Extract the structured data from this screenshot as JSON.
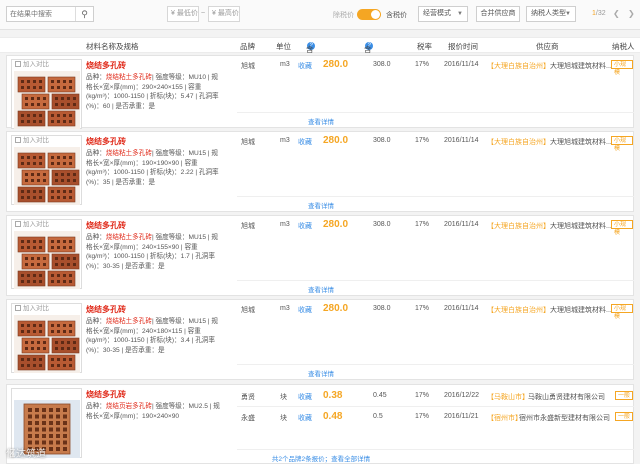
{
  "toolbar": {
    "search_placeholder": "在结果中搜索",
    "price_min": "¥ 最低价",
    "price_max": "¥ 最高价",
    "tilde": "~",
    "toggle_left": "除税价",
    "toggle_right": "含税价",
    "sort_mode": "经营模式",
    "merge_supplier": "合并供应商",
    "taxpayer_type": "纳税人类型",
    "page_current": "1",
    "page_total": "/32",
    "accent": "#f5a623"
  },
  "table_header": {
    "name": "材料名称及规格",
    "brand": "品牌",
    "unit": "单位",
    "market_price": "含税市场价",
    "info_price": "含税信息价",
    "tax_rate": "税率",
    "report_time": "报价时间",
    "supplier": "供应商",
    "taxpayer": "纳税人"
  },
  "cards": [
    {
      "compare": "加入对比",
      "name": "烧结多孔砖",
      "spec_lines": [
        [
          "品种：",
          "烧结粘土多孔砖",
          "| 强度等级：MU10 | 规"
        ],
        [
          "格长×宽×厚(mm)：290×240×155 | 容重"
        ],
        [
          "(kg/m³)：1000-1150 | 折标(块)：5.47 | 孔洞率"
        ],
        [
          "(%)：60 | 是否承重：是"
        ]
      ],
      "rows": [
        {
          "brand": "旭城",
          "unit": "m3",
          "fav": "收藏",
          "price": "280.0",
          "info": "308.0",
          "tax": "17%",
          "time": "2016/11/14",
          "region": "【大理白族自治州】",
          "supplier": "大理旭城建筑材料...",
          "tag": "小规模"
        }
      ],
      "more": "查看详情"
    },
    {
      "compare": "加入对比",
      "name": "烧结多孔砖",
      "spec_lines": [
        [
          "品种：",
          "烧结粘土多孔砖",
          "| 强度等级：MU15 | 规"
        ],
        [
          "格长×宽×厚(mm)：190×190×90 | 容重"
        ],
        [
          "(kg/m³)：1000-1150 | 折标(块)：2.22 | 孔洞率"
        ],
        [
          "(%)：35 | 是否承重：是"
        ]
      ],
      "rows": [
        {
          "brand": "旭城",
          "unit": "m3",
          "fav": "收藏",
          "price": "280.0",
          "info": "308.0",
          "tax": "17%",
          "time": "2016/11/14",
          "region": "【大理白族自治州】",
          "supplier": "大理旭城建筑材料...",
          "tag": "小规模"
        }
      ],
      "more": "查看详情"
    },
    {
      "compare": "加入对比",
      "name": "烧结多孔砖",
      "spec_lines": [
        [
          "品种：",
          "烧结粘土多孔砖",
          "| 强度等级：MU15 | 规"
        ],
        [
          "格长×宽×厚(mm)：240×155×90 | 容重"
        ],
        [
          "(kg/m³)：1000-1150 | 折标(块)：1.7 | 孔洞率"
        ],
        [
          "(%)：30-35 | 是否承重：是"
        ]
      ],
      "rows": [
        {
          "brand": "旭城",
          "unit": "m3",
          "fav": "收藏",
          "price": "280.0",
          "info": "308.0",
          "tax": "17%",
          "time": "2016/11/14",
          "region": "【大理白族自治州】",
          "supplier": "大理旭城建筑材料...",
          "tag": "小规模"
        }
      ],
      "more": "查看详情"
    },
    {
      "compare": "加入对比",
      "name": "烧结多孔砖",
      "spec_lines": [
        [
          "品种：",
          "烧结粘土多孔砖",
          "| 强度等级：MU15 | 规"
        ],
        [
          "格长×宽×厚(mm)：240×180×115 | 容重"
        ],
        [
          "(kg/m³)：1000-1150 | 折标(块)：3.4 | 孔洞率"
        ],
        [
          "(%)：30-35 | 是否承重：是"
        ]
      ],
      "rows": [
        {
          "brand": "旭城",
          "unit": "m3",
          "fav": "收藏",
          "price": "280.0",
          "info": "308.0",
          "tax": "17%",
          "time": "2016/11/14",
          "region": "【大理白族自治州】",
          "supplier": "大理旭城建筑材料...",
          "tag": "小规模"
        }
      ],
      "more": "查看详情"
    },
    {
      "compare": "",
      "name": "烧结多孔砖",
      "spec_lines": [
        [
          "品种：",
          "烧结页岩多孔砖",
          "| 强度等级：MU2.5 | 规"
        ],
        [
          "格长×宽×厚(mm)：190×240×90"
        ]
      ],
      "rows": [
        {
          "brand": "勇贤",
          "unit": "块",
          "fav": "收藏",
          "price": "0.38",
          "info": "0.45",
          "tax": "17%",
          "time": "2016/12/22",
          "region": "【马鞍山市】",
          "supplier": "马鞍山勇贤建材有限公司",
          "tag": "一般"
        },
        {
          "brand": "永盛",
          "unit": "块",
          "fav": "收藏",
          "price": "0.48",
          "info": "0.5",
          "tax": "17%",
          "time": "2016/11/21",
          "region": "【宿州市】",
          "supplier": "宿州市永盛新型建材有限公司",
          "tag": "一般"
        }
      ],
      "more": "共2个品牌2条报价；查看全部详情"
    }
  ],
  "watermark": "亿达筑道"
}
